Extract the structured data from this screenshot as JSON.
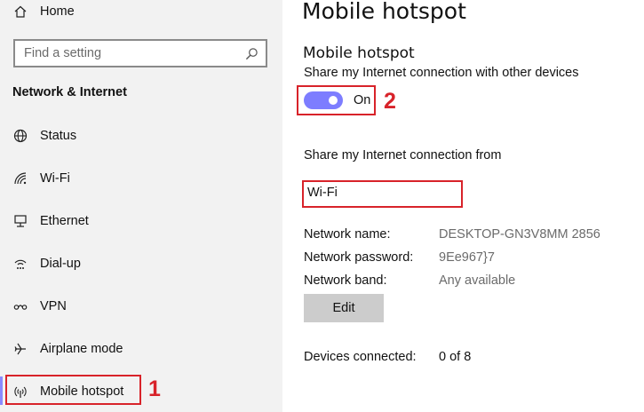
{
  "sidebar": {
    "home": {
      "label": "Home",
      "icon": "home-icon"
    },
    "search": {
      "placeholder": "Find a setting",
      "icon": "search-icon"
    },
    "section_heading": "Network & Internet",
    "items": [
      {
        "label": "Status",
        "icon": "globe-icon"
      },
      {
        "label": "Wi-Fi",
        "icon": "wifi-icon"
      },
      {
        "label": "Ethernet",
        "icon": "ethernet-icon"
      },
      {
        "label": "Dial-up",
        "icon": "dialup-icon"
      },
      {
        "label": "VPN",
        "icon": "vpn-icon"
      },
      {
        "label": "Airplane mode",
        "icon": "airplane-icon"
      },
      {
        "label": "Mobile hotspot",
        "icon": "hotspot-icon",
        "active": true
      }
    ]
  },
  "main": {
    "page_title": "Mobile hotspot",
    "section_title": "Mobile hotspot",
    "share_description": "Share my Internet connection with other devices",
    "toggle": {
      "state": "On",
      "on": true
    },
    "share_from_label": "Share my Internet connection from",
    "share_from_value": "Wi-Fi",
    "network_name_label": "Network name:",
    "network_name_value": "DESKTOP-GN3V8MM 2856",
    "network_password_label": "Network password:",
    "network_password_value": "9Ee967}7",
    "network_band_label": "Network band:",
    "network_band_value": "Any available",
    "edit_label": "Edit",
    "devices_connected_label": "Devices connected:",
    "devices_connected_value": "0 of 8"
  },
  "annotations": {
    "callout_1": "1",
    "callout_2": "2",
    "highlight_color": "#d8232a"
  },
  "colors": {
    "accent": "#7d7dff",
    "sidebar_bg": "#f2f2f2"
  }
}
